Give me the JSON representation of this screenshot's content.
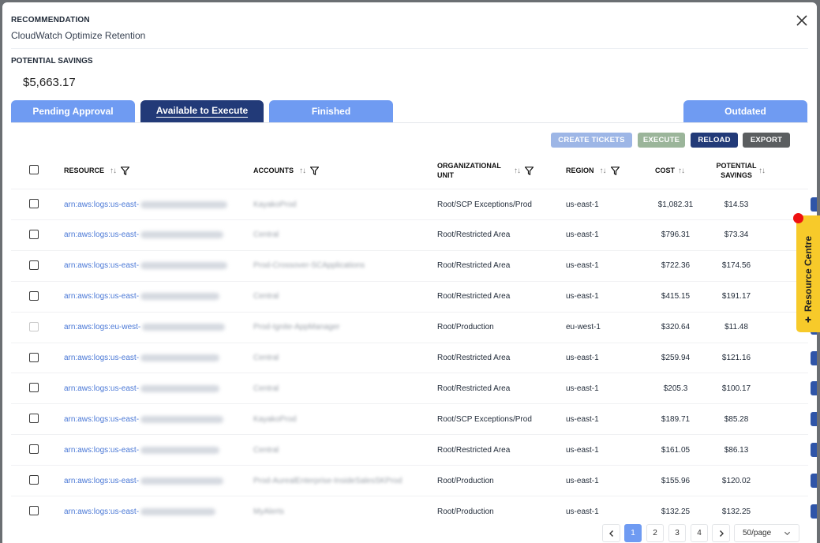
{
  "header": {
    "label": "RECOMMENDATION",
    "title": "CloudWatch Optimize Retention"
  },
  "savings": {
    "label": "POTENTIAL SAVINGS",
    "value": "$5,663.17"
  },
  "tabs": [
    {
      "label": "Pending Approval",
      "active": false
    },
    {
      "label": "Available to Execute",
      "active": true
    },
    {
      "label": "Finished",
      "active": false
    },
    {
      "label": "Outdated",
      "active": false
    }
  ],
  "actions": {
    "create_tickets": "CREATE TICKETS",
    "execute": "EXECUTE",
    "reload": "RELOAD",
    "export": "EXPORT"
  },
  "columns": {
    "resource": "RESOURCE",
    "accounts": "ACCOUNTS",
    "org_unit": "ORGANIZATIONAL UNIT",
    "region": "REGION",
    "cost": "COST",
    "savings": "POTENTIAL SAVINGS"
  },
  "sort_glyph": "↑↓",
  "rows": [
    {
      "resource": "arn:aws:logs:us-east-",
      "account": "KayakoProd",
      "org": "Root/SCP Exceptions/Prod",
      "region": "us-east-1",
      "cost": "$1,082.31",
      "savings": "$14.53"
    },
    {
      "resource": "arn:aws:logs:us-east-",
      "account": "Central",
      "org": "Root/Restricted Area",
      "region": "us-east-1",
      "cost": "$796.31",
      "savings": "$73.34"
    },
    {
      "resource": "arn:aws:logs:us-east-",
      "account": "Prod-Crossover-SCApplications",
      "org": "Root/Restricted Area",
      "region": "us-east-1",
      "cost": "$722.36",
      "savings": "$174.56"
    },
    {
      "resource": "arn:aws:logs:us-east-",
      "account": "Central",
      "org": "Root/Restricted Area",
      "region": "us-east-1",
      "cost": "$415.15",
      "savings": "$191.17"
    },
    {
      "resource": "arn:aws:logs:eu-west-",
      "account": "Prod-Ignite-AppManager",
      "org": "Root/Production",
      "region": "eu-west-1",
      "cost": "$320.64",
      "savings": "$11.48"
    },
    {
      "resource": "arn:aws:logs:us-east-",
      "account": "Central",
      "org": "Root/Restricted Area",
      "region": "us-east-1",
      "cost": "$259.94",
      "savings": "$121.16"
    },
    {
      "resource": "arn:aws:logs:us-east-",
      "account": "Central",
      "org": "Root/Restricted Area",
      "region": "us-east-1",
      "cost": "$205.3",
      "savings": "$100.17"
    },
    {
      "resource": "arn:aws:logs:us-east-",
      "account": "KayakoProd",
      "org": "Root/SCP Exceptions/Prod",
      "region": "us-east-1",
      "cost": "$189.71",
      "savings": "$85.28"
    },
    {
      "resource": "arn:aws:logs:us-east-",
      "account": "Central",
      "org": "Root/Restricted Area",
      "region": "us-east-1",
      "cost": "$161.05",
      "savings": "$86.13"
    },
    {
      "resource": "arn:aws:logs:us-east-",
      "account": "Prod-AurealEnterprise-InsideSalesSKProd",
      "org": "Root/Production",
      "region": "us-east-1",
      "cost": "$155.96",
      "savings": "$120.02"
    },
    {
      "resource": "arn:aws:logs:us-east-",
      "account": "MyAlerts",
      "org": "Root/Production",
      "region": "us-east-1",
      "cost": "$132.25",
      "savings": "$132.25"
    }
  ],
  "pagination": {
    "pages": [
      "1",
      "2",
      "3",
      "4"
    ],
    "current": "1",
    "page_size": "50/page"
  },
  "resource_centre": {
    "label": "Resource Centre"
  }
}
